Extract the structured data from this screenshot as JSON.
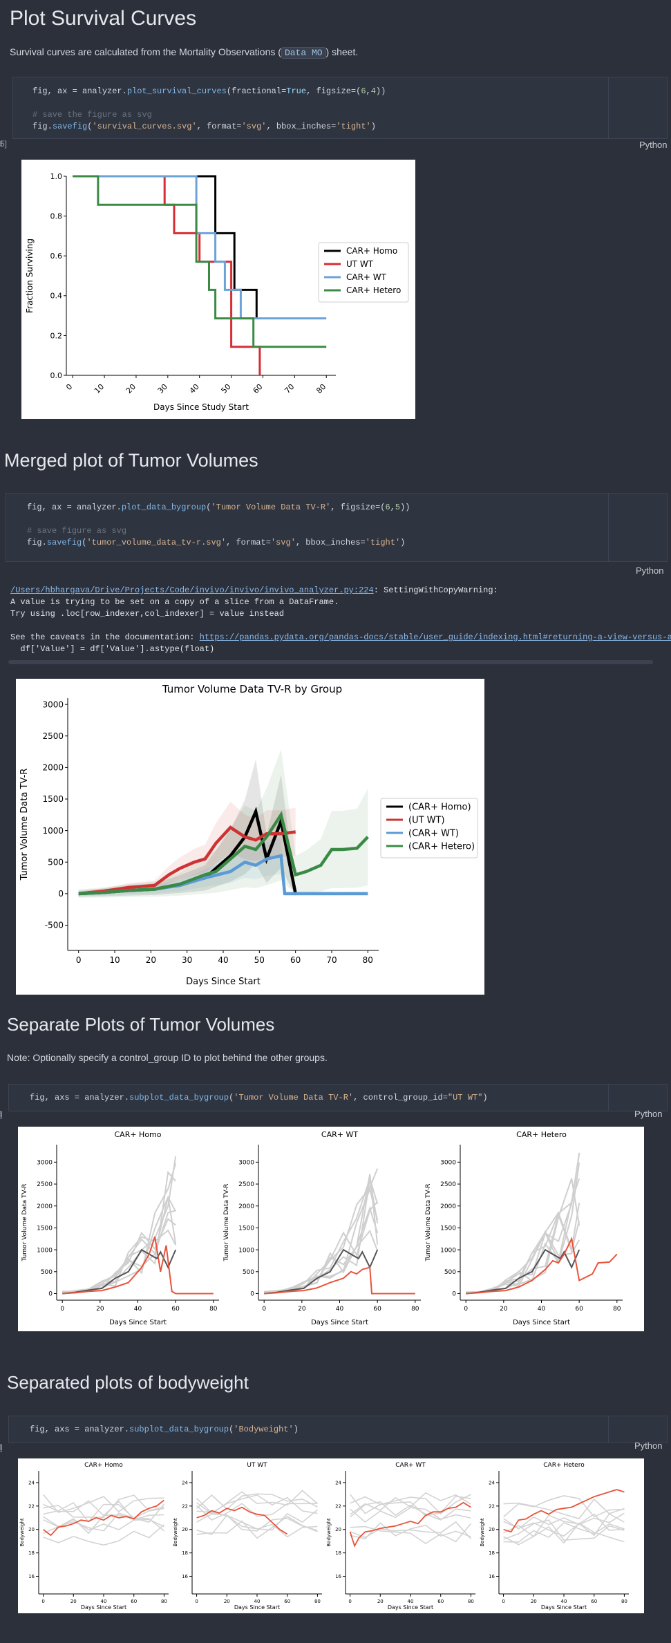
{
  "sections": {
    "survival_title": "Plot Survival Curves",
    "survival_desc_before": "Survival curves are calculated from the Mortality Observations (",
    "survival_desc_code": "Data MO",
    "survival_desc_after": ") sheet.",
    "merged_title": "Merged plot of Tumor Volumes",
    "separate_title": "Separate Plots of Tumor Volumes",
    "separate_note": "Note: Optionally specify a control_group ID to plot behind the other groups.",
    "bodyweight_title": "Separated plots of bodyweight"
  },
  "cells": {
    "cell1": {
      "language": "Python",
      "execution_marker": "5]"
    },
    "cell2": {
      "language": "Python"
    },
    "cell3": {
      "language": "Python",
      "execution_marker": "]"
    },
    "cell4": {
      "language": "Python",
      "execution_marker": "]"
    }
  },
  "warning": {
    "path": "/Users/hbhargava/Drive/Projects/Code/invivo/invivo/invivo_analyzer.py:224",
    "type": ": SettingWithCopyWarning:",
    "line2": "A value is trying to be set on a copy of a slice from a DataFrame.",
    "line3": "Try using .loc[row_indexer,col_indexer] = value instead",
    "line5_prefix": "See the caveats in the documentation: ",
    "line5_link": "https://pandas.pydata.org/pandas-docs/stable/user_guide/indexing.html#returning-a-view-versus-a-cop",
    "line6": "  df['Value'] = df['Value'].astype(float)"
  },
  "colors": {
    "black": "#000000",
    "red": "#d62d35",
    "blue": "#5b9bd5",
    "green": "#2e7d32",
    "accent_red": "#e8533a",
    "dark_gray": "#555555",
    "light_gray": "#d0d0d0"
  },
  "chart_data": [
    {
      "id": "survival",
      "type": "line",
      "step": true,
      "xlabel": "Days Since Study Start",
      "ylabel": "Fraction Surviving",
      "xlim": [
        -2,
        83
      ],
      "ylim": [
        0,
        1.0
      ],
      "xticks": [
        "0",
        "10",
        "20",
        "30",
        "40",
        "50",
        "60",
        "70",
        "80"
      ],
      "yticks": [
        "0.0",
        "0.2",
        "0.4",
        "0.6",
        "0.8",
        "1.0"
      ],
      "legend_position": "right",
      "series": [
        {
          "name": "CAR+ Homo",
          "color": "#000000",
          "x": [
            0,
            45,
            45,
            51,
            51,
            58,
            58
          ],
          "y": [
            1,
            1,
            0.714,
            0.714,
            0.429,
            0.429,
            0.286
          ]
        },
        {
          "name": "UT WT",
          "color": "#d62d35",
          "x": [
            0,
            29,
            29,
            32,
            32,
            40,
            40,
            50,
            50,
            59,
            59
          ],
          "y": [
            1,
            1,
            0.857,
            0.857,
            0.714,
            0.714,
            0.571,
            0.571,
            0.143,
            0.143,
            0
          ]
        },
        {
          "name": "CAR+ WT",
          "color": "#6aa3d8",
          "x": [
            0,
            39,
            39,
            45,
            45,
            48,
            48,
            53,
            53,
            80
          ],
          "y": [
            1,
            1,
            0.714,
            0.714,
            0.571,
            0.571,
            0.429,
            0.429,
            0.286,
            0.286
          ]
        },
        {
          "name": "CAR+ Hetero",
          "color": "#3a8a46",
          "x": [
            0,
            8,
            8,
            39,
            39,
            43,
            43,
            45,
            45,
            57,
            57,
            80
          ],
          "y": [
            1,
            1,
            0.857,
            0.857,
            0.571,
            0.571,
            0.429,
            0.429,
            0.286,
            0.286,
            0.143,
            0.143
          ]
        }
      ]
    },
    {
      "id": "merged",
      "type": "line",
      "title": "Tumor Volume Data TV-R by Group",
      "xlabel": "Days Since Start",
      "ylabel": "Tumor Volume Data TV-R",
      "xlim": [
        -3,
        83
      ],
      "ylim": [
        -900,
        3100
      ],
      "xticks": [
        "0",
        "10",
        "20",
        "30",
        "40",
        "50",
        "60",
        "70",
        "80"
      ],
      "yticks": [
        "-500",
        "0",
        "500",
        "1000",
        "1500",
        "2000",
        "2500",
        "3000"
      ],
      "legend_position": "right",
      "series": [
        {
          "name": "(CAR+ Homo)",
          "color": "#000000",
          "x": [
            0,
            7,
            14,
            21,
            28,
            35,
            42,
            46,
            49,
            52,
            56,
            60
          ],
          "y": [
            0,
            20,
            50,
            70,
            150,
            250,
            600,
            900,
            1300,
            550,
            1150,
            0
          ]
        },
        {
          "name": "(UT WT)",
          "color": "#cc3333",
          "x": [
            0,
            7,
            14,
            21,
            25,
            28,
            32,
            35,
            38,
            42,
            46,
            49,
            52,
            56,
            60
          ],
          "y": [
            0,
            40,
            100,
            130,
            300,
            400,
            500,
            550,
            800,
            1050,
            900,
            850,
            950,
            950,
            980
          ]
        },
        {
          "name": "(CAR+ WT)",
          "color": "#5b9bd5",
          "x": [
            0,
            7,
            14,
            21,
            28,
            35,
            42,
            46,
            49,
            52,
            56,
            57,
            60,
            80
          ],
          "y": [
            0,
            20,
            50,
            70,
            130,
            250,
            350,
            500,
            450,
            550,
            600,
            0,
            0,
            0
          ]
        },
        {
          "name": "(CAR+ Hetero)",
          "color": "#3a8a46",
          "x": [
            0,
            7,
            14,
            21,
            28,
            35,
            38,
            42,
            46,
            49,
            52,
            56,
            60,
            63,
            67,
            70,
            73,
            77,
            80
          ],
          "y": [
            0,
            20,
            50,
            70,
            150,
            300,
            350,
            550,
            750,
            700,
            900,
            1250,
            300,
            350,
            450,
            700,
            700,
            720,
            900
          ]
        }
      ]
    },
    {
      "id": "separate",
      "type": "line",
      "panels": [
        "CAR+ Homo",
        "CAR+ WT",
        "CAR+ Hetero"
      ],
      "xlabel": "Days Since Start",
      "ylabel": "Tumor Volume Data TV-R",
      "xlim": [
        -3,
        83
      ],
      "ylim": [
        -150,
        3400
      ],
      "xticks": [
        "0",
        "20",
        "40",
        "60",
        "80"
      ],
      "yticks": [
        "0",
        "500",
        "1000",
        "1500",
        "2000",
        "2500",
        "3000"
      ],
      "control_mean": {
        "x": [
          0,
          7,
          14,
          21,
          28,
          35,
          42,
          46,
          50,
          52,
          56,
          60
        ],
        "y": [
          0,
          30,
          80,
          120,
          350,
          500,
          1000,
          900,
          800,
          950,
          600,
          1000
        ]
      },
      "group_means": [
        {
          "x": [
            0,
            7,
            14,
            21,
            28,
            35,
            42,
            46,
            49,
            52,
            55,
            58,
            60,
            80
          ],
          "y": [
            0,
            20,
            50,
            70,
            150,
            250,
            600,
            900,
            1300,
            500,
            1100,
            50,
            0,
            0
          ]
        },
        {
          "x": [
            0,
            7,
            14,
            21,
            28,
            35,
            42,
            46,
            49,
            52,
            56,
            57,
            60,
            80
          ],
          "y": [
            0,
            20,
            50,
            70,
            130,
            250,
            350,
            500,
            450,
            550,
            600,
            0,
            0,
            0
          ]
        },
        {
          "x": [
            0,
            7,
            14,
            21,
            28,
            35,
            42,
            46,
            49,
            52,
            56,
            60,
            67,
            70,
            76,
            80
          ],
          "y": [
            0,
            20,
            50,
            70,
            150,
            300,
            550,
            750,
            700,
            900,
            1250,
            300,
            450,
            700,
            720,
            900
          ]
        }
      ]
    },
    {
      "id": "bodyweight",
      "type": "line",
      "panels": [
        "CAR+ Homo",
        "UT WT",
        "CAR+ WT",
        "CAR+ Hetero"
      ],
      "xlabel": "Days Since Start",
      "ylabel": "Bodyweight",
      "xlim": [
        -3,
        83
      ],
      "ylim": [
        14.5,
        25
      ],
      "xticks": [
        "0",
        "20",
        "40",
        "60",
        "80"
      ],
      "yticks": [
        "16",
        "18",
        "20",
        "22",
        "24"
      ],
      "group_means": [
        {
          "x": [
            0,
            5,
            10,
            15,
            20,
            25,
            30,
            35,
            40,
            45,
            50,
            55,
            60,
            65,
            70,
            75,
            80
          ],
          "y": [
            20,
            19.5,
            20.2,
            20.3,
            20.5,
            20.8,
            20.7,
            21,
            20.8,
            21.2,
            21,
            21.1,
            20.9,
            21.5,
            21.8,
            22,
            22.5
          ]
        },
        {
          "x": [
            0,
            5,
            10,
            15,
            20,
            25,
            30,
            35,
            40,
            45,
            50,
            55,
            60
          ],
          "y": [
            21,
            21.2,
            21.6,
            21.4,
            21.8,
            21.6,
            21.9,
            21.5,
            21.3,
            21.2,
            20.6,
            20.0,
            19.6
          ]
        },
        {
          "x": [
            0,
            3,
            6,
            10,
            15,
            20,
            25,
            30,
            35,
            40,
            45,
            50,
            55,
            60,
            65,
            70,
            75,
            80
          ],
          "y": [
            19.8,
            18.6,
            19.3,
            19.8,
            19.9,
            20.1,
            20.2,
            20.3,
            20.5,
            20.7,
            20.5,
            21.2,
            21.5,
            21.5,
            21.8,
            21.9,
            22.3,
            21.9
          ]
        },
        {
          "x": [
            0,
            5,
            10,
            15,
            20,
            25,
            30,
            35,
            40,
            45,
            50,
            55,
            60,
            65,
            70,
            75,
            80
          ],
          "y": [
            20,
            19.8,
            20.8,
            20.9,
            21.3,
            21.6,
            21.3,
            21.7,
            21.8,
            21.9,
            22.2,
            22.5,
            22.8,
            23,
            23.2,
            23.4,
            23.2
          ]
        }
      ]
    }
  ]
}
